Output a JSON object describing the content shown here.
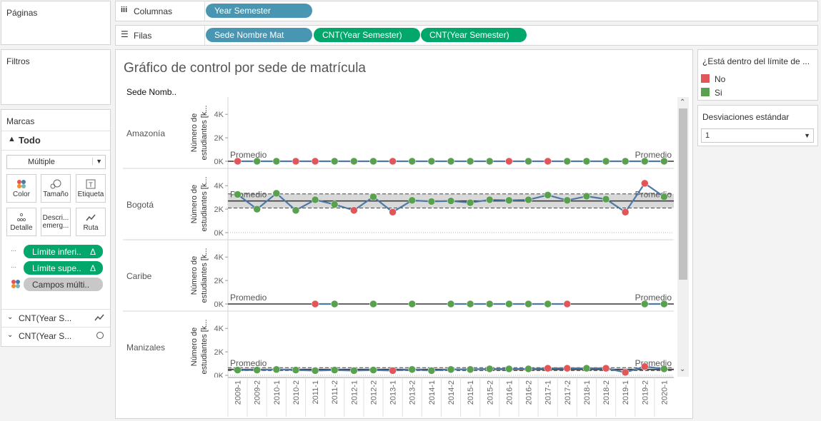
{
  "cards": {
    "paginas": "Páginas",
    "filtros": "Filtros",
    "marcas": "Marcas"
  },
  "shelves": {
    "columnas_label": "Columnas",
    "filas_label": "Filas",
    "columnas_pill": "Year Semester",
    "filas_pills": [
      "Sede Nombre Mat",
      "CNT(Year Semester)",
      "CNT(Year Semester)"
    ]
  },
  "marks": {
    "all_label": "Todo",
    "mark_type": "Múltiple",
    "buttons": [
      "Color",
      "Tamaño",
      "Etiqueta",
      "Detalle",
      "Descri... emerg...",
      "Ruta"
    ],
    "fields": [
      "Límite inferi..",
      "Límite supe..",
      "Campos múlti.."
    ],
    "delta_symbol": "Δ",
    "sub_cards": [
      "CNT(Year S...",
      "CNT(Year S..."
    ]
  },
  "chart": {
    "title": "Gráfico de control por sede de matrícula",
    "row_header": "Sede Nomb..",
    "y_axis_title": "Número de estudiantes [k...",
    "avg_label": "Promedio"
  },
  "legend": {
    "title": "¿Está dentro del límite de ...",
    "items": [
      {
        "label": "No",
        "color": "#e15759"
      },
      {
        "label": "Si",
        "color": "#59a14f"
      }
    ]
  },
  "param": {
    "title": "Desviaciones estándar",
    "value": "1"
  },
  "colors": {
    "line": "#4e79a7",
    "no": "#e15759",
    "si": "#59a14f",
    "band": "#d9d9d9"
  },
  "chart_data": {
    "type": "line",
    "x": [
      "2009-1",
      "2009-2",
      "2010-1",
      "2010-2",
      "2011-1",
      "2011-2",
      "2012-1",
      "2012-2",
      "2013-1",
      "2013-2",
      "2014-1",
      "2014-2",
      "2015-1",
      "2015-2",
      "2016-1",
      "2016-2",
      "2017-1",
      "2017-2",
      "2018-1",
      "2018-2",
      "2019-1",
      "2019-2",
      "2020-1"
    ],
    "y_ticks": [
      "4K",
      "2K",
      "0K"
    ],
    "ylim": [
      0,
      4500
    ],
    "panels": [
      {
        "name": "Amazonía",
        "values": [
          0,
          0,
          0,
          0,
          0,
          0,
          0,
          0,
          0,
          0,
          0,
          0,
          0,
          0,
          0,
          0,
          0,
          0,
          0,
          0,
          0,
          0,
          0
        ],
        "status": [
          "No",
          "Si",
          "Si",
          "No",
          "No",
          "Si",
          "Si",
          "Si",
          "No",
          "Si",
          "Si",
          "Si",
          "Si",
          "Si",
          "No",
          "Si",
          "No",
          "Si",
          "Si",
          "Si",
          "Si",
          "Si",
          "Si"
        ],
        "avg": 0,
        "lower": 0,
        "upper": 0
      },
      {
        "name": "Bogotá",
        "values": [
          3250,
          2000,
          3350,
          1900,
          2800,
          2400,
          1900,
          3050,
          1750,
          2750,
          2650,
          2700,
          2550,
          2800,
          2750,
          2800,
          3200,
          2750,
          3100,
          2850,
          1750,
          4200,
          3050
        ],
        "status": [
          "Si",
          "Si",
          "Si",
          "Si",
          "Si",
          "Si",
          "No",
          "Si",
          "No",
          "Si",
          "Si",
          "Si",
          "Si",
          "Si",
          "Si",
          "Si",
          "Si",
          "Si",
          "Si",
          "Si",
          "No",
          "No",
          "Si"
        ],
        "avg": 2700,
        "lower": 2100,
        "upper": 3300
      },
      {
        "name": "Caribe",
        "values": [
          null,
          null,
          null,
          null,
          0,
          0,
          null,
          0,
          null,
          0,
          null,
          0,
          0,
          0,
          0,
          0,
          0,
          0,
          null,
          null,
          null,
          0,
          0
        ],
        "status": [
          null,
          null,
          null,
          null,
          "No",
          "Si",
          null,
          "Si",
          null,
          "Si",
          null,
          "Si",
          "Si",
          "Si",
          "Si",
          "Si",
          "Si",
          "No",
          null,
          null,
          null,
          "Si",
          "Si"
        ],
        "avg": 0,
        "lower": 0,
        "upper": 0
      },
      {
        "name": "Manizales",
        "values": [
          450,
          450,
          500,
          450,
          400,
          450,
          400,
          450,
          400,
          500,
          400,
          500,
          500,
          550,
          550,
          550,
          600,
          600,
          600,
          600,
          250,
          750,
          550
        ],
        "status": [
          "Si",
          "Si",
          "Si",
          "Si",
          "Si",
          "Si",
          "Si",
          "Si",
          "No",
          "Si",
          "Si",
          "Si",
          "Si",
          "Si",
          "Si",
          "Si",
          "No",
          "No",
          "Si",
          "No",
          "No",
          "No",
          "Si"
        ],
        "avg": 500,
        "lower": 400,
        "upper": 650
      }
    ]
  }
}
